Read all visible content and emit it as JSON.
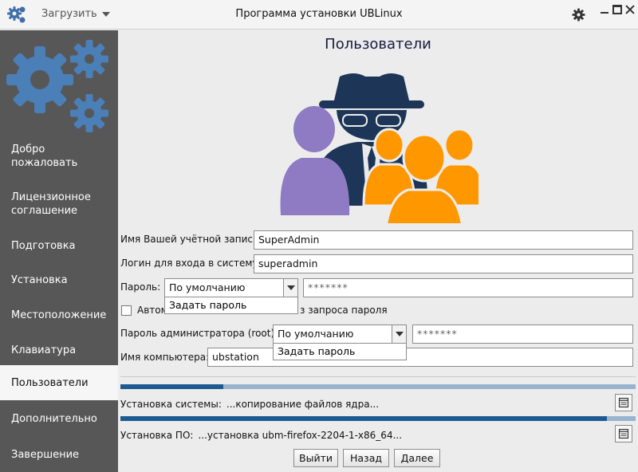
{
  "titlebar": {
    "menu_label": "Загрузить",
    "title": "Программа установки UBLinux"
  },
  "sidebar": {
    "items": [
      {
        "label": "Добро пожаловать",
        "active": false
      },
      {
        "label": "Лицензионное соглашение",
        "active": false
      },
      {
        "label": "Подготовка",
        "active": false
      },
      {
        "label": "Установка",
        "active": false
      },
      {
        "label": "Местоположение",
        "active": false
      },
      {
        "label": "Клавиатура",
        "active": false
      },
      {
        "label": "Пользователи",
        "active": true
      },
      {
        "label": "Дополнительно",
        "active": false
      },
      {
        "label": "Завершение",
        "active": false
      }
    ]
  },
  "page": {
    "title": "Пользователи"
  },
  "form": {
    "account_name_label": "Имя Вашей учётной записи:",
    "account_name_value": "SuperAdmin",
    "login_label": "Логин для входа в систему:",
    "login_value": "superadmin",
    "password_label": "Пароль:",
    "password_mode": "По умолчанию",
    "password_option": "Задать пароль",
    "password_value": "*******",
    "autologin_label_start": "Автом",
    "autologin_label_end": "з запроса пароля",
    "root_password_label": "Пароль администратора (root):",
    "root_password_mode": "По умолчанию",
    "root_password_option": "Задать пароль",
    "root_password_value": "*******",
    "hostname_label": "Имя компьютера:",
    "hostname_value": "ubstation"
  },
  "progress": {
    "system_label": "Установка системы:",
    "system_status": "...копирование файлов ядра...",
    "system_fraction": 0.2,
    "software_label": "Установка ПО:",
    "software_status": "...установка ubm-firefox-2204-1-x86_64...",
    "software_fraction": 0.945
  },
  "buttons": {
    "exit": "Выйти",
    "back": "Назад",
    "next": "Далее"
  },
  "colors": {
    "sidebar_bg": "#575757",
    "accent_blue": "#1e5a92",
    "gear_blue": "#4a7fb8",
    "user_purple": "#8e7bc4",
    "user_orange": "#ff9800",
    "spy_navy": "#1d3557"
  }
}
